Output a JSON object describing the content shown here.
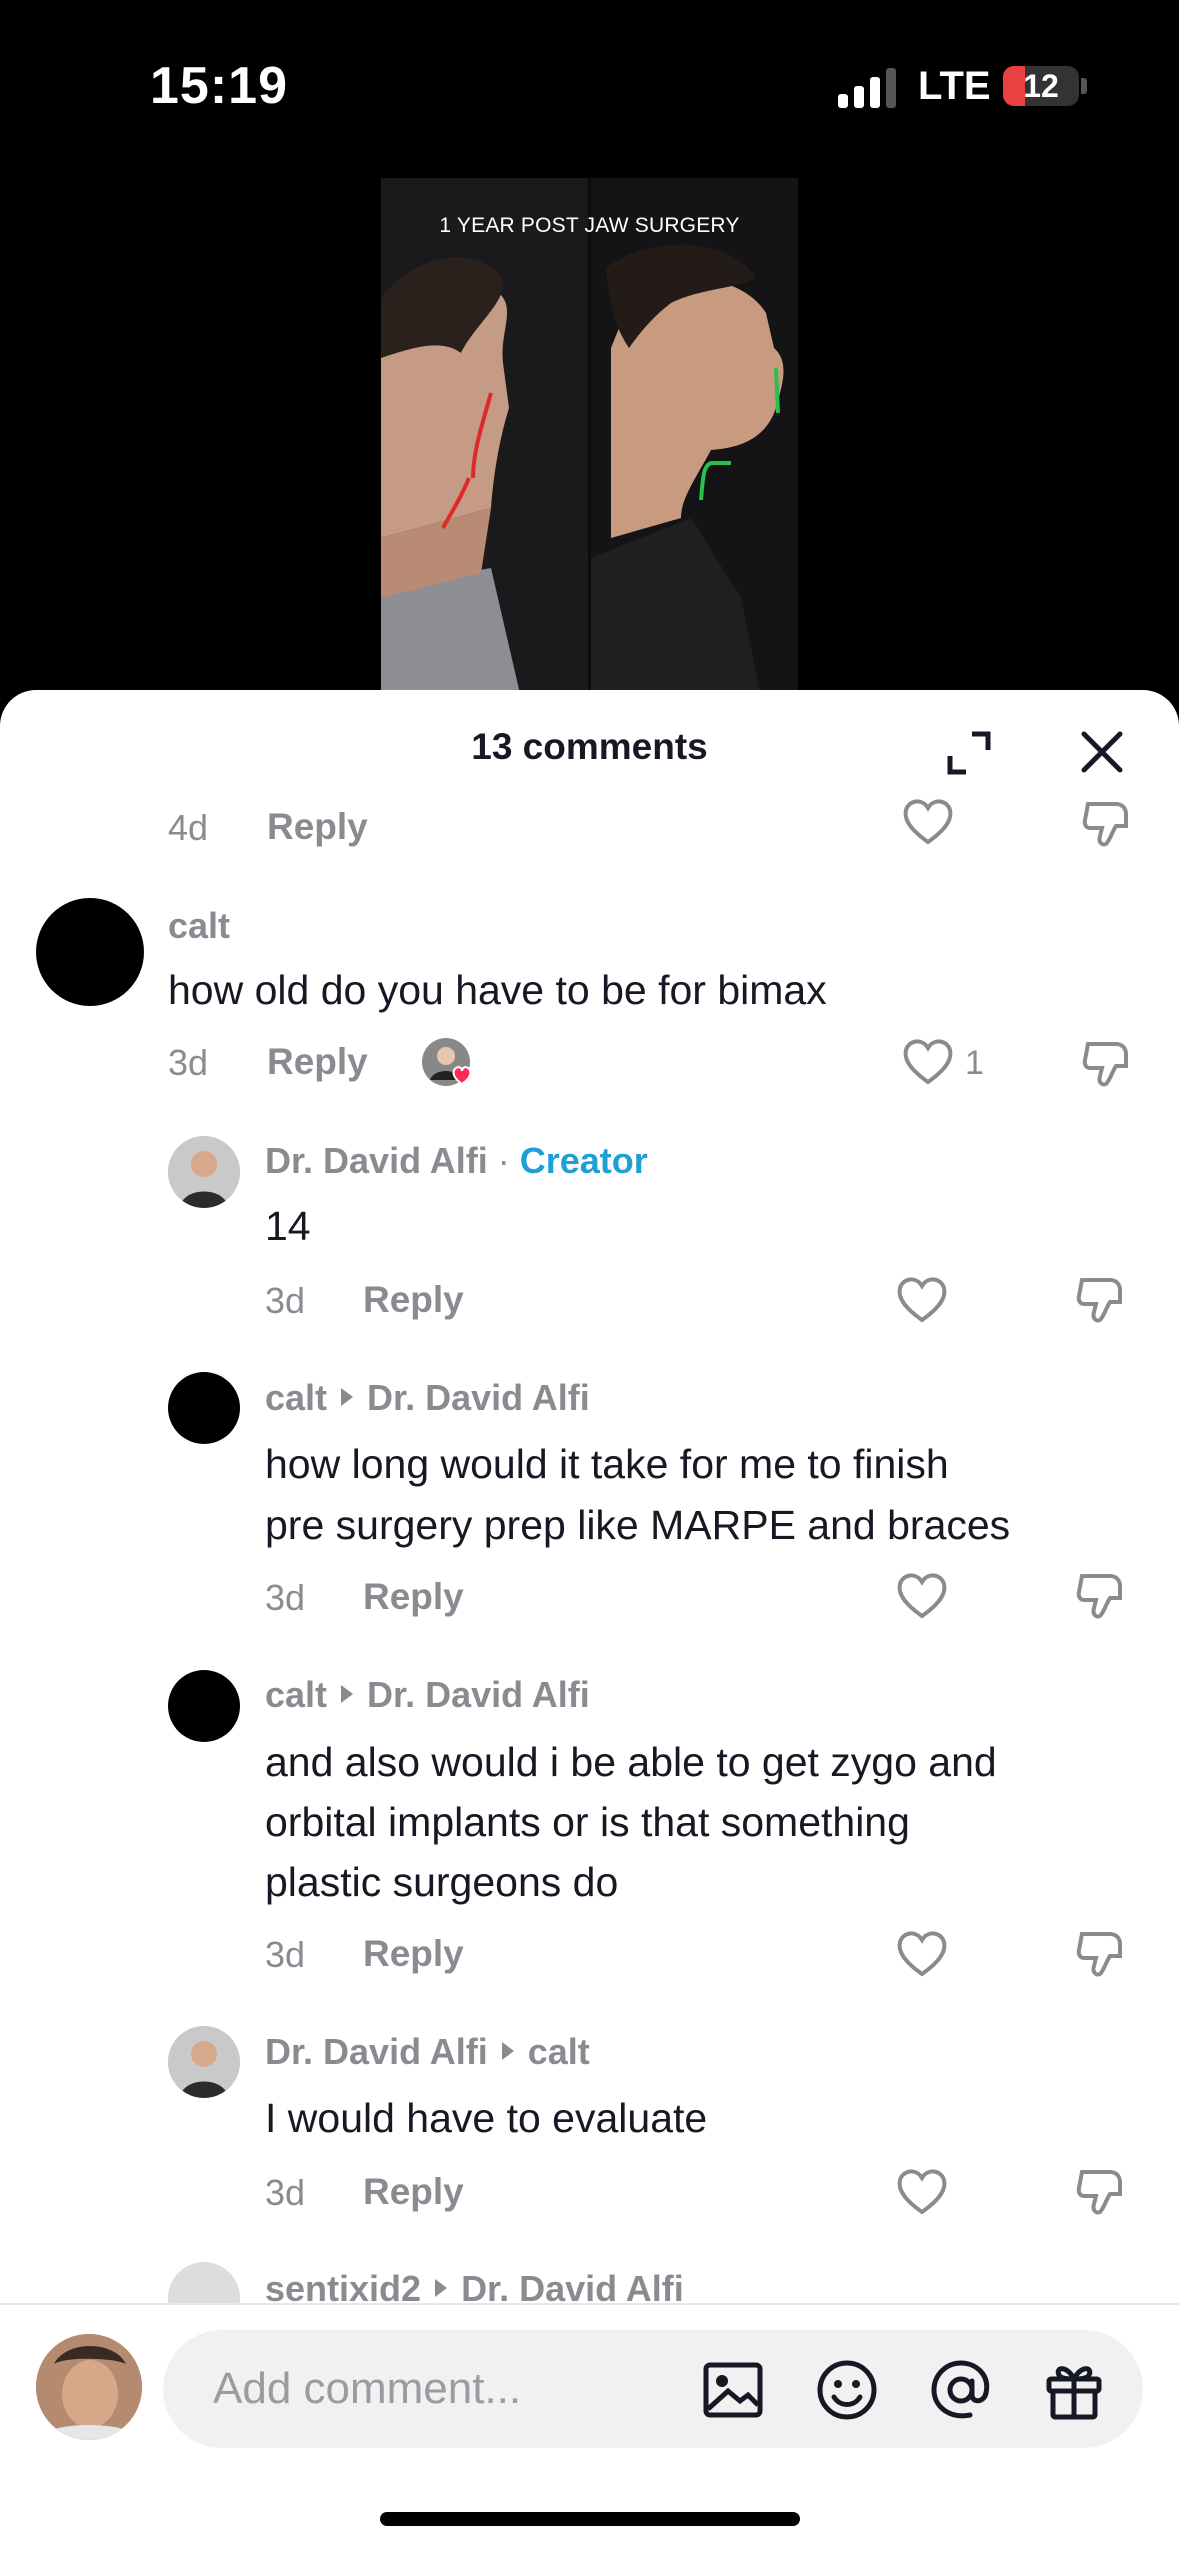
{
  "status_bar": {
    "time": "15:19",
    "network": "LTE",
    "battery": "12"
  },
  "video": {
    "caption": "1 YEAR POST JAW SURGERY"
  },
  "sheet": {
    "title": "13 comments"
  },
  "top_partial": {
    "time": "4d",
    "reply": "Reply"
  },
  "comments": [
    {
      "author": "calt",
      "text": "how old do you have to be for bimax",
      "time": "3d",
      "reply": "Reply",
      "likes": "1"
    },
    {
      "author": "Dr. David Alfi",
      "separator": "·",
      "badge": "Creator",
      "text": "14",
      "time": "3d",
      "reply": "Reply"
    },
    {
      "author": "calt",
      "reply_to": "Dr. David Alfi",
      "text_lines": [
        "how long would it take for me to finish",
        "pre surgery prep like MARPE and braces"
      ],
      "time": "3d",
      "reply": "Reply"
    },
    {
      "author": "calt",
      "reply_to": "Dr. David Alfi",
      "text_lines": [
        "and also would i be able to get zygo and",
        "orbital implants or is that something",
        "plastic surgeons do"
      ],
      "time": "3d",
      "reply": "Reply"
    },
    {
      "author": "Dr. David Alfi",
      "reply_to": "calt",
      "text": "I would have to evaluate",
      "time": "3d",
      "reply": "Reply"
    },
    {
      "author": "sentixid2",
      "reply_to": "Dr. David Alfi"
    }
  ],
  "composer": {
    "placeholder": "Add comment..."
  },
  "icons": {
    "expand": "expand-icon",
    "close": "close-icon",
    "heart": "heart-icon",
    "dislike": "dislike-icon",
    "image": "image-icon",
    "emoji": "emoji-icon",
    "mention": "at-icon",
    "gift": "gift-icon"
  },
  "colors": {
    "creator_badge": "#1e9fd6",
    "battery_low": "#e8413f",
    "meta_grey": "#8a8b91"
  }
}
